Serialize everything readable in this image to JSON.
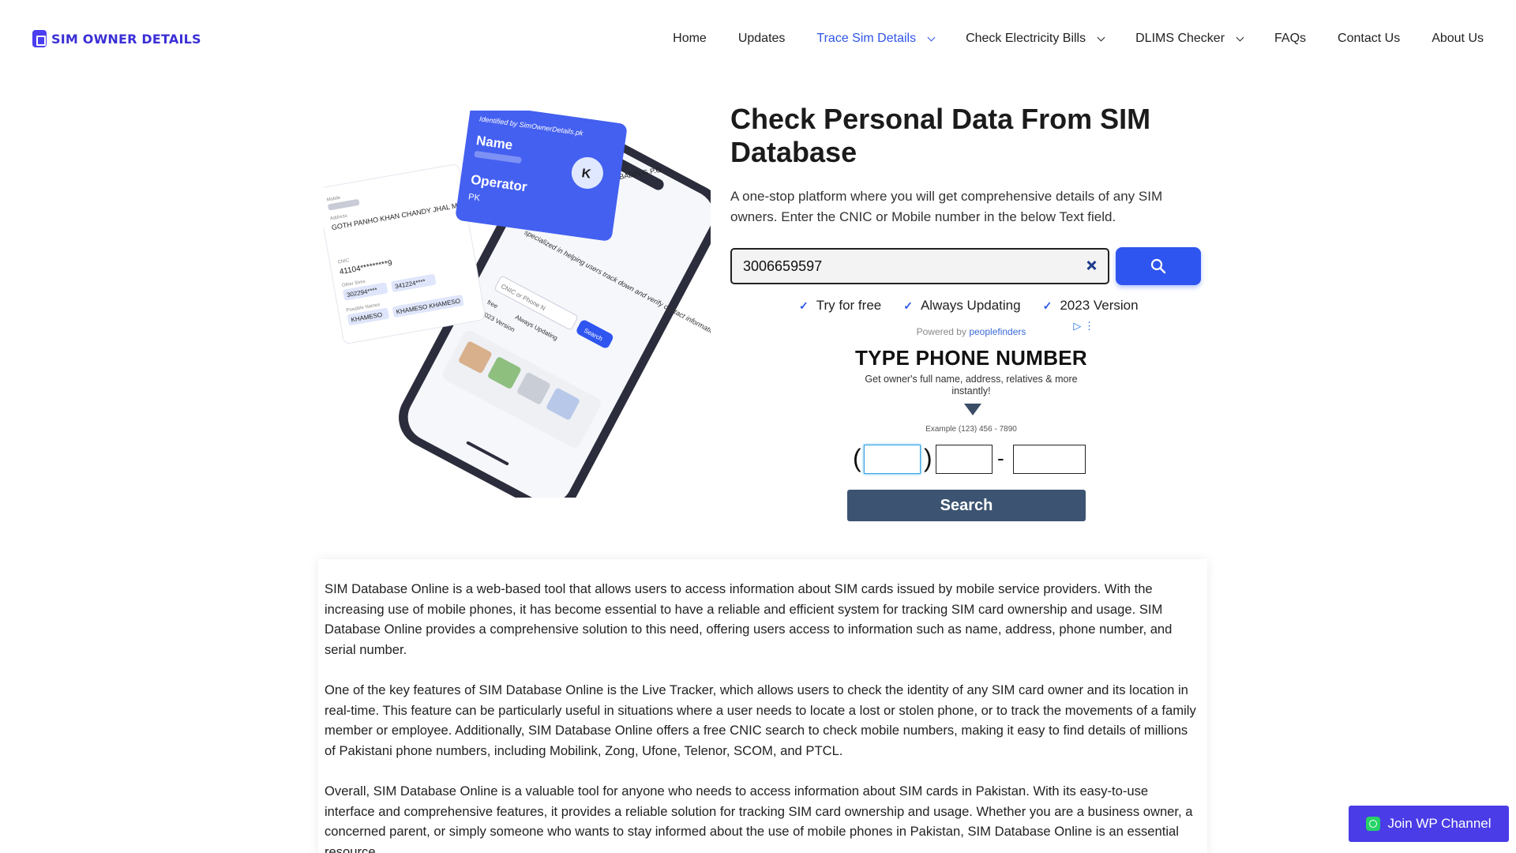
{
  "header": {
    "logo_text": "SIM OWNER DETAILS",
    "nav": [
      {
        "label": "Home"
      },
      {
        "label": "Updates"
      },
      {
        "label": "Trace Sim Details"
      },
      {
        "label": "Check Electricity Bills"
      },
      {
        "label": "DLIMS Checker"
      },
      {
        "label": "FAQs"
      },
      {
        "label": "Contact Us"
      },
      {
        "label": "About Us"
      }
    ]
  },
  "hero": {
    "title": "Check Personal Data From SIM Database",
    "description": "A one-stop platform where you will get comprehensive details of any SIM owners. Enter the CNIC or Mobile number in the below Text field.",
    "search_value": "3006659597",
    "features": [
      "Try for free",
      "Always Updating",
      "2023 Version"
    ],
    "illustration": {
      "blue_card_top": "Identified by SimOwnerDetails.pk",
      "blue_card_name": "Name",
      "blue_card_operator": "Operator",
      "blue_card_operator_value": "PK",
      "avatar_letter": "K",
      "white_card_mobile_label": "Mobile",
      "white_card_address_label": "Address",
      "white_card_address": "GOTH PANHO KHAN CHANDY JHAL MORI TEHSI IL TANDO BAAGO DISTRICT BADEEN BADIN G.P.O.",
      "white_card_cnic_label": "CNIC",
      "white_card_cnic": "41104*********9",
      "white_card_other_sims_label": "Other Sims",
      "white_card_sim1": "302294****",
      "white_card_sim2": "341224****",
      "white_card_names_label": "Possible Names",
      "white_card_name1": "KHAMESO",
      "white_card_name2": "KHAMESO KHAMESO",
      "phone_text1": "specialized in helping users track down and verify contact information, including phone numbers, in Pakistan.",
      "phone_placeholder": "CNIC or Phone N",
      "phone_search": "Search",
      "phone_free": "free",
      "phone_updating": "Always Updating",
      "phone_version": "2023 Version"
    }
  },
  "ad": {
    "powered_prefix": "Powered by",
    "powered_brand": "peoplefinders",
    "title": "TYPE PHONE NUMBER",
    "subtitle": "Get owner's full name, address, relatives & more instantly!",
    "example": "Example (123) 456 - 7890",
    "button": "Search"
  },
  "article": {
    "paragraphs": [
      "SIM Database Online is a web-based tool that allows users to access information about SIM cards issued by mobile service providers. With the increasing use of mobile phones, it has become essential to have a reliable and efficient system for tracking SIM card ownership and usage. SIM Database Online provides a comprehensive solution to this need, offering users access to information such as name, address, phone number, and serial number.",
      "One of the key features of SIM Database Online is the Live Tracker, which allows users to check the identity of any SIM card owner and its location in real-time. This feature can be particularly useful in situations where a user needs to locate a lost or stolen phone, or to track the movements of a family member or employee. Additionally, SIM Database Online offers a free CNIC search to check mobile numbers, making it easy to find details of millions of Pakistani phone numbers, including Mobilink, Zong, Ufone, Telenor, SCOM, and PTCL.",
      "Overall, SIM Database Online is a valuable tool for anyone who needs to access information about SIM cards in Pakistan. With its easy-to-use interface and comprehensive features, it provides a reliable solution for tracking SIM card ownership and usage. Whether you are a business owner, a concerned parent, or simply someone who wants to stay informed about the use of mobile phones in Pakistan, SIM Database Online is an essential resource."
    ]
  },
  "floating": {
    "wp_button": "Join WP Channel"
  },
  "colors": {
    "accent": "#2f55f0",
    "brand": "#3b2fd6",
    "ad_button": "#3c5472",
    "wp_button": "#4a3ce6"
  }
}
